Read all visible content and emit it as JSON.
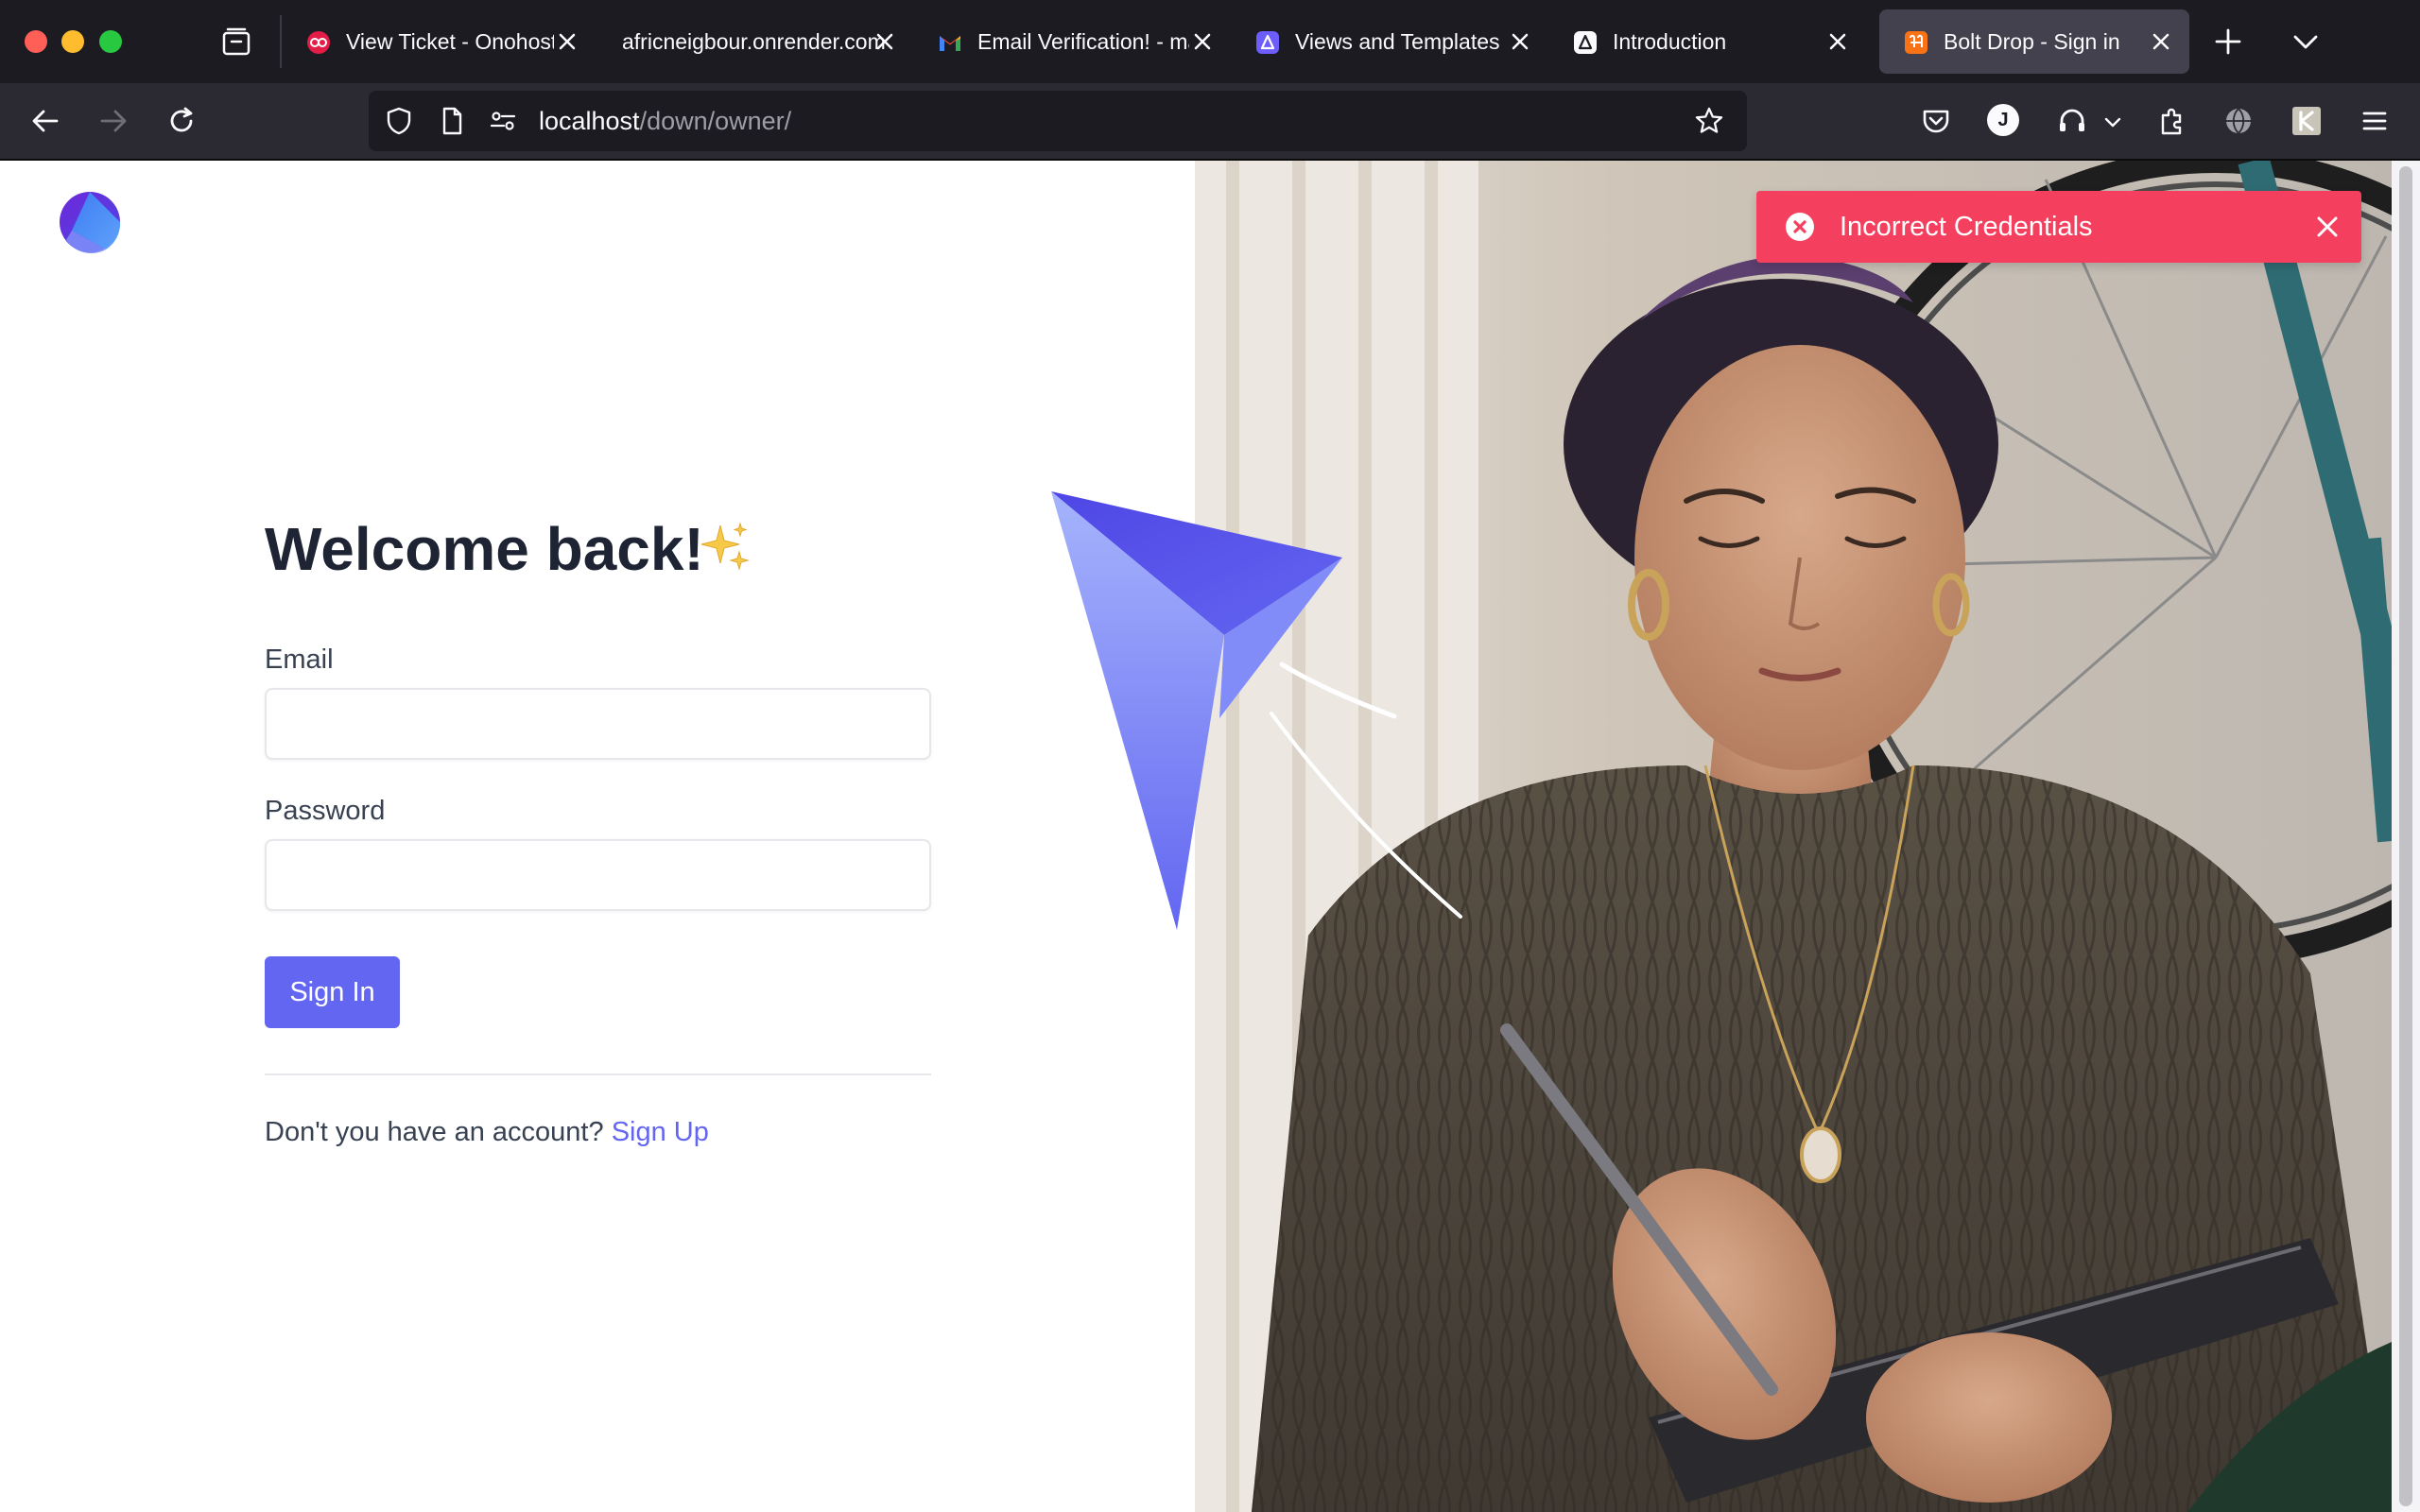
{
  "browser": {
    "tabs": [
      {
        "label": "View Ticket - Onohosting",
        "favicon": "onohosting-favicon",
        "active": false
      },
      {
        "label": "africneigbour.onrender.com",
        "favicon": "none",
        "active": false
      },
      {
        "label": "Email Verification! - mail",
        "favicon": "gmail-favicon",
        "active": false
      },
      {
        "label": "Views and Templates",
        "favicon": "docs-favicon",
        "active": false
      },
      {
        "label": "Introduction",
        "favicon": "docs-favicon",
        "active": false
      },
      {
        "label": "Bolt Drop - Sign in",
        "favicon": "bolt-drop-favicon",
        "active": true
      }
    ],
    "url": {
      "host": "localhost",
      "path": "/down/owner/"
    },
    "profile_initial": "J",
    "colors": {
      "chrome_dark": "#1c1b22",
      "toolbar": "#2b2a33",
      "active_tab": "#42414d"
    }
  },
  "page": {
    "title": "Welcome back!",
    "title_emoji": "sparkles-icon",
    "email": {
      "label": "Email",
      "value": "",
      "placeholder": ""
    },
    "password": {
      "label": "Password",
      "value": "",
      "placeholder": ""
    },
    "signin_label": "Sign In",
    "signup_prompt": "Don't you have an account?",
    "signup_link": "Sign Up",
    "colors": {
      "primary": "#6366f1",
      "heading": "#1e2433",
      "text": "#374151"
    }
  },
  "toast": {
    "message": "Incorrect Credentials",
    "type": "error",
    "color": "#f43f5e"
  }
}
